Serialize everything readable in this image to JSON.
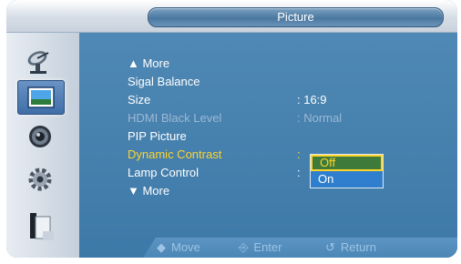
{
  "title": "Picture",
  "menu": {
    "more_top": "▲ More",
    "items": [
      {
        "label": "Sigal Balance",
        "value": ""
      },
      {
        "label": "Size",
        "value": ": 16:9"
      },
      {
        "label": "HDMI Black Level",
        "value": ": Normal",
        "disabled": true
      },
      {
        "label": "PIP Picture",
        "value": ""
      },
      {
        "label": "Dynamic Contrast",
        "value": ":",
        "highlighted": true
      },
      {
        "label": "Lamp Control",
        "value": ":"
      }
    ],
    "more_bottom": "▼ More"
  },
  "dropdown": {
    "options": [
      "Off",
      "On"
    ],
    "selected": "Off"
  },
  "sidebar": {
    "icons": [
      "satellite-dish-icon",
      "picture-icon",
      "speaker-icon",
      "gear-icon",
      "document-icon"
    ],
    "selected": "picture-icon"
  },
  "footer": {
    "move_icon": "◆",
    "move_label": "Move",
    "enter_icon": "⎆",
    "enter_label": "Enter",
    "return_icon": "↺",
    "return_label": "Return"
  },
  "colors": {
    "highlight": "#ffd42a",
    "panel": "#4a85b3",
    "dropdown_selected": "#3e7a3a",
    "dropdown_option": "#2f7fce"
  }
}
